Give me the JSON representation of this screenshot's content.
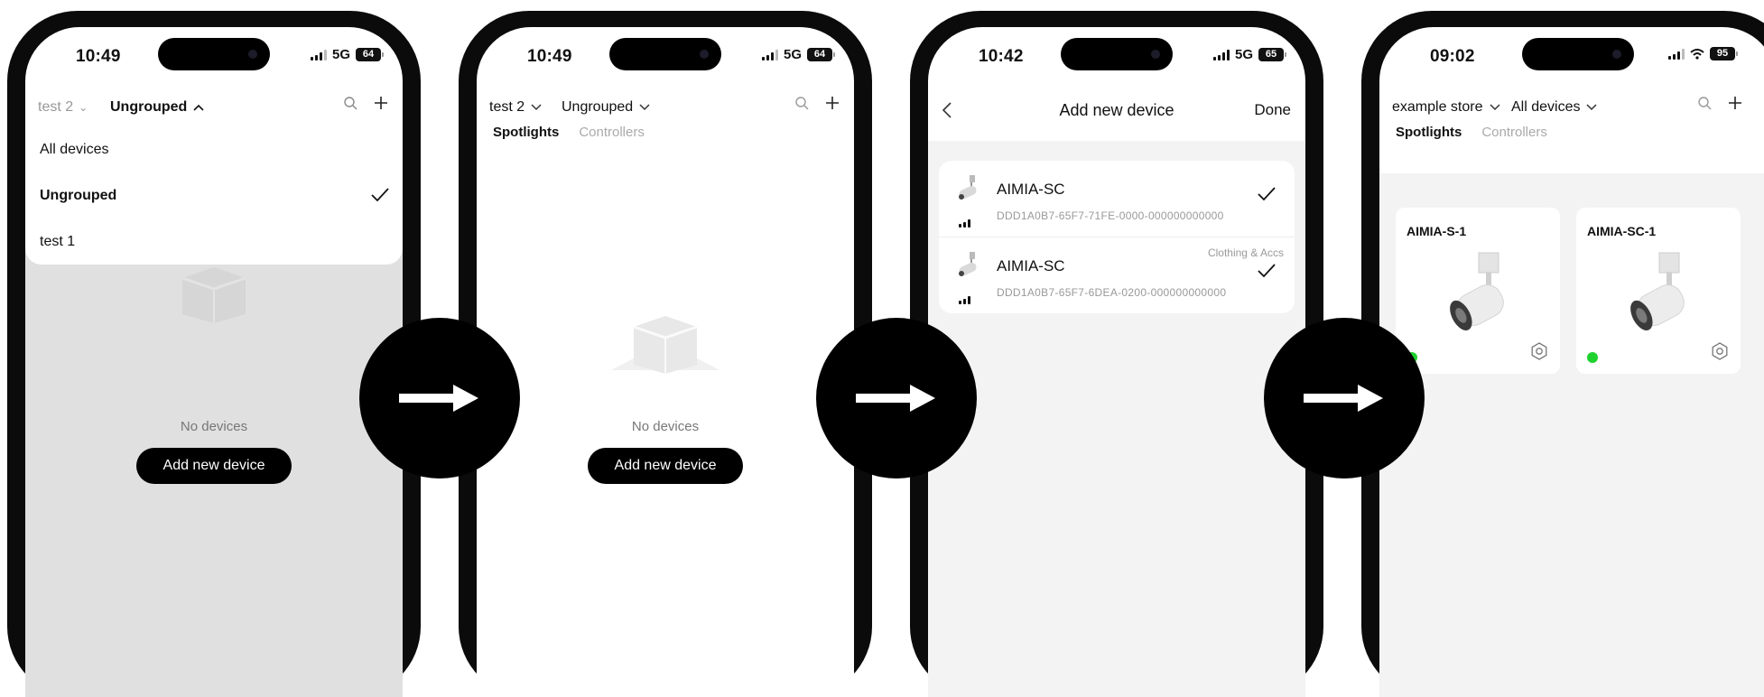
{
  "screens": [
    {
      "status": {
        "time": "10:49",
        "network": "5G",
        "battery": "64"
      },
      "header": {
        "store": "test 2",
        "group": "Ungrouped"
      },
      "dropdown": {
        "items": [
          "All devices",
          "Ungrouped",
          "test 1"
        ],
        "selected": "Ungrouped"
      },
      "empty": {
        "text": "No devices",
        "button": "Add new device"
      }
    },
    {
      "status": {
        "time": "10:49",
        "network": "5G",
        "battery": "64"
      },
      "header": {
        "store": "test 2",
        "group": "Ungrouped"
      },
      "tabs": [
        "Spotlights",
        "Controllers"
      ],
      "empty": {
        "text": "No devices",
        "button": "Add new device"
      }
    },
    {
      "status": {
        "time": "10:42",
        "network": "5G",
        "battery": "65"
      },
      "header": {
        "title": "Add new device",
        "done": "Done"
      },
      "devices": [
        {
          "name": "AIMIA-SC",
          "id": "DDD1A0B7-65F7-71FE-0000-000000000000",
          "tag": ""
        },
        {
          "name": "AIMIA-SC",
          "id": "DDD1A0B7-65F7-6DEA-0200-000000000000",
          "tag": "Clothing & Accs"
        }
      ]
    },
    {
      "status": {
        "time": "09:02",
        "battery": "95"
      },
      "header": {
        "store": "example store",
        "group": "All devices"
      },
      "tabs": [
        "Spotlights",
        "Controllers"
      ],
      "tiles": [
        {
          "name": "AIMIA-S-1"
        },
        {
          "name": "AIMIA-SC-1"
        }
      ]
    }
  ],
  "icons": [
    "search-icon",
    "plus-icon",
    "chevron-down-icon",
    "chevron-up-icon",
    "check-icon",
    "back-icon",
    "gear-icon",
    "arrow-right-icon",
    "empty-box-icon",
    "spotlight-icon",
    "signal-icon",
    "wifi-icon",
    "battery-icon"
  ],
  "colors": {
    "accent": "#000000",
    "online": "#1fd12e",
    "muted": "#999999"
  }
}
